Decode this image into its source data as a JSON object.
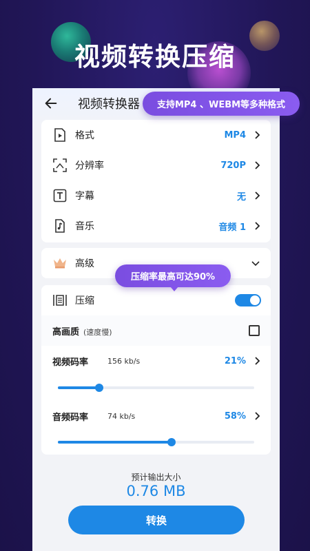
{
  "headline": "视频转换压缩",
  "topbar": {
    "title": "视频转换器"
  },
  "tooltips": {
    "formats": "支持MP4 、WEBM等多种格式",
    "compression": "压缩率最高可达90%"
  },
  "settings": [
    {
      "icon": "video-file-icon",
      "label": "格式",
      "value": "MP4"
    },
    {
      "icon": "resolution-icon",
      "label": "分辨率",
      "value": "720P"
    },
    {
      "icon": "subtitle-icon",
      "label": "字幕",
      "value": "无"
    },
    {
      "icon": "music-note-icon",
      "label": "音乐",
      "value": "音频 1"
    }
  ],
  "advanced": {
    "icon": "crown-icon",
    "label": "高级"
  },
  "compress": {
    "icon": "compress-icon",
    "label": "压缩",
    "enabled": true,
    "high_quality": {
      "label": "高画质",
      "note": "(速度慢)",
      "checked": false
    },
    "video_bitrate": {
      "label": "视频码率",
      "rate": "156 kb/s",
      "percent": "21%",
      "level": 0.21
    },
    "audio_bitrate": {
      "label": "音频码率",
      "rate": "74 kb/s",
      "percent": "58%",
      "level": 0.58
    }
  },
  "estimate": {
    "label": "预计输出大小",
    "value": "0.76 MB"
  },
  "convert_button": "转换",
  "colors": {
    "accent": "#1e88e5",
    "background": "#23185a",
    "tooltip": "#7a4de0"
  }
}
